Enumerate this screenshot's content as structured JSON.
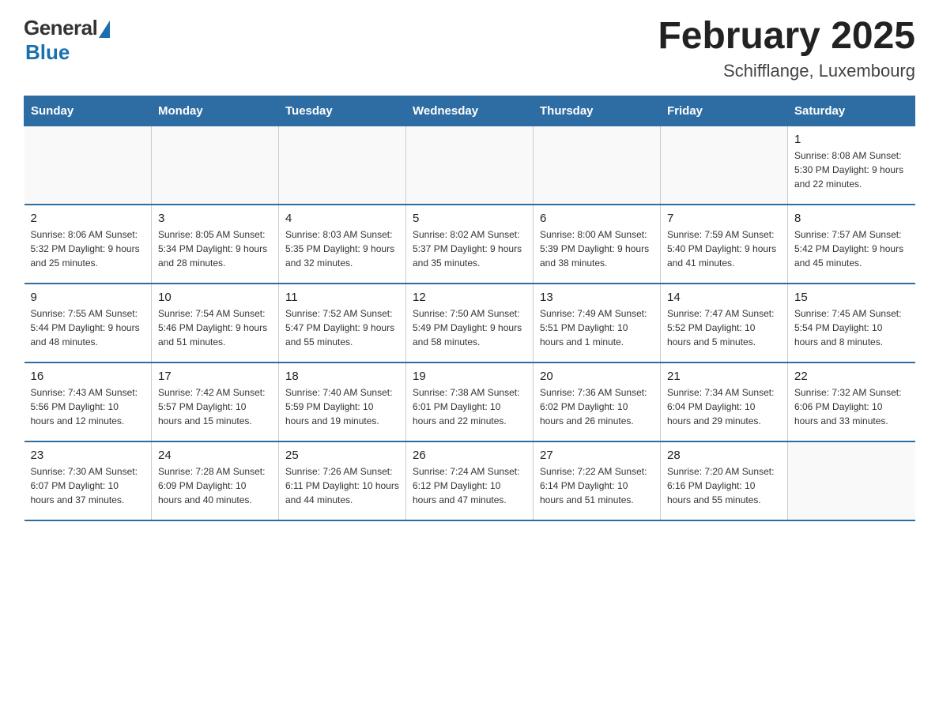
{
  "logo": {
    "general": "General",
    "blue": "Blue"
  },
  "title": "February 2025",
  "subtitle": "Schifflange, Luxembourg",
  "days_of_week": [
    "Sunday",
    "Monday",
    "Tuesday",
    "Wednesday",
    "Thursday",
    "Friday",
    "Saturday"
  ],
  "weeks": [
    [
      {
        "day": "",
        "info": ""
      },
      {
        "day": "",
        "info": ""
      },
      {
        "day": "",
        "info": ""
      },
      {
        "day": "",
        "info": ""
      },
      {
        "day": "",
        "info": ""
      },
      {
        "day": "",
        "info": ""
      },
      {
        "day": "1",
        "info": "Sunrise: 8:08 AM\nSunset: 5:30 PM\nDaylight: 9 hours and 22 minutes."
      }
    ],
    [
      {
        "day": "2",
        "info": "Sunrise: 8:06 AM\nSunset: 5:32 PM\nDaylight: 9 hours and 25 minutes."
      },
      {
        "day": "3",
        "info": "Sunrise: 8:05 AM\nSunset: 5:34 PM\nDaylight: 9 hours and 28 minutes."
      },
      {
        "day": "4",
        "info": "Sunrise: 8:03 AM\nSunset: 5:35 PM\nDaylight: 9 hours and 32 minutes."
      },
      {
        "day": "5",
        "info": "Sunrise: 8:02 AM\nSunset: 5:37 PM\nDaylight: 9 hours and 35 minutes."
      },
      {
        "day": "6",
        "info": "Sunrise: 8:00 AM\nSunset: 5:39 PM\nDaylight: 9 hours and 38 minutes."
      },
      {
        "day": "7",
        "info": "Sunrise: 7:59 AM\nSunset: 5:40 PM\nDaylight: 9 hours and 41 minutes."
      },
      {
        "day": "8",
        "info": "Sunrise: 7:57 AM\nSunset: 5:42 PM\nDaylight: 9 hours and 45 minutes."
      }
    ],
    [
      {
        "day": "9",
        "info": "Sunrise: 7:55 AM\nSunset: 5:44 PM\nDaylight: 9 hours and 48 minutes."
      },
      {
        "day": "10",
        "info": "Sunrise: 7:54 AM\nSunset: 5:46 PM\nDaylight: 9 hours and 51 minutes."
      },
      {
        "day": "11",
        "info": "Sunrise: 7:52 AM\nSunset: 5:47 PM\nDaylight: 9 hours and 55 minutes."
      },
      {
        "day": "12",
        "info": "Sunrise: 7:50 AM\nSunset: 5:49 PM\nDaylight: 9 hours and 58 minutes."
      },
      {
        "day": "13",
        "info": "Sunrise: 7:49 AM\nSunset: 5:51 PM\nDaylight: 10 hours and 1 minute."
      },
      {
        "day": "14",
        "info": "Sunrise: 7:47 AM\nSunset: 5:52 PM\nDaylight: 10 hours and 5 minutes."
      },
      {
        "day": "15",
        "info": "Sunrise: 7:45 AM\nSunset: 5:54 PM\nDaylight: 10 hours and 8 minutes."
      }
    ],
    [
      {
        "day": "16",
        "info": "Sunrise: 7:43 AM\nSunset: 5:56 PM\nDaylight: 10 hours and 12 minutes."
      },
      {
        "day": "17",
        "info": "Sunrise: 7:42 AM\nSunset: 5:57 PM\nDaylight: 10 hours and 15 minutes."
      },
      {
        "day": "18",
        "info": "Sunrise: 7:40 AM\nSunset: 5:59 PM\nDaylight: 10 hours and 19 minutes."
      },
      {
        "day": "19",
        "info": "Sunrise: 7:38 AM\nSunset: 6:01 PM\nDaylight: 10 hours and 22 minutes."
      },
      {
        "day": "20",
        "info": "Sunrise: 7:36 AM\nSunset: 6:02 PM\nDaylight: 10 hours and 26 minutes."
      },
      {
        "day": "21",
        "info": "Sunrise: 7:34 AM\nSunset: 6:04 PM\nDaylight: 10 hours and 29 minutes."
      },
      {
        "day": "22",
        "info": "Sunrise: 7:32 AM\nSunset: 6:06 PM\nDaylight: 10 hours and 33 minutes."
      }
    ],
    [
      {
        "day": "23",
        "info": "Sunrise: 7:30 AM\nSunset: 6:07 PM\nDaylight: 10 hours and 37 minutes."
      },
      {
        "day": "24",
        "info": "Sunrise: 7:28 AM\nSunset: 6:09 PM\nDaylight: 10 hours and 40 minutes."
      },
      {
        "day": "25",
        "info": "Sunrise: 7:26 AM\nSunset: 6:11 PM\nDaylight: 10 hours and 44 minutes."
      },
      {
        "day": "26",
        "info": "Sunrise: 7:24 AM\nSunset: 6:12 PM\nDaylight: 10 hours and 47 minutes."
      },
      {
        "day": "27",
        "info": "Sunrise: 7:22 AM\nSunset: 6:14 PM\nDaylight: 10 hours and 51 minutes."
      },
      {
        "day": "28",
        "info": "Sunrise: 7:20 AM\nSunset: 6:16 PM\nDaylight: 10 hours and 55 minutes."
      },
      {
        "day": "",
        "info": ""
      }
    ]
  ]
}
